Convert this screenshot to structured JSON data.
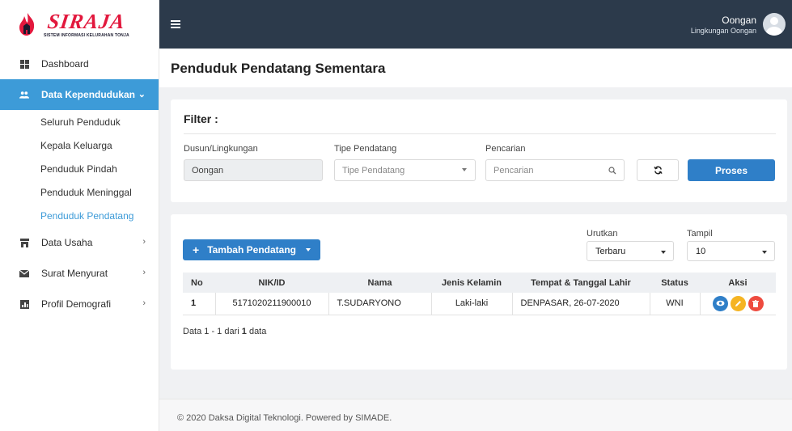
{
  "logo": {
    "word": "SIRAJA",
    "subtitle": "SISTEM INFORMASI KELURAHAN TONJA"
  },
  "sidebar": {
    "items": [
      {
        "label": "Dashboard"
      },
      {
        "label": "Data Kependudukan"
      },
      {
        "label": "Data Usaha"
      },
      {
        "label": "Surat Menyurat"
      },
      {
        "label": "Profil Demografi"
      }
    ],
    "sub_items": [
      {
        "label": "Seluruh Penduduk"
      },
      {
        "label": "Kepala Keluarga"
      },
      {
        "label": "Penduduk Pindah"
      },
      {
        "label": "Penduduk Meninggal"
      },
      {
        "label": "Penduduk Pendatang"
      }
    ]
  },
  "user": {
    "name": "Oongan",
    "location": "Lingkungan Oongan"
  },
  "page": {
    "title": "Penduduk Pendatang Sementara"
  },
  "filter": {
    "title": "Filter :",
    "dusun_label": "Dusun/Lingkungan",
    "dusun_value": "Oongan",
    "tipe_label": "Tipe Pendatang",
    "tipe_placeholder": "Tipe Pendatang",
    "search_label": "Pencarian",
    "search_placeholder": "Pencarian",
    "proses_label": "Proses"
  },
  "toolbar": {
    "add_label": "Tambah Pendatang",
    "sort_label": "Urutkan",
    "sort_value": "Terbaru",
    "show_label": "Tampil",
    "show_value": "10"
  },
  "table": {
    "headers": [
      "No",
      "NIK/ID",
      "Nama",
      "Jenis Kelamin",
      "Tempat & Tanggal Lahir",
      "Status",
      "Aksi"
    ],
    "rows": [
      {
        "no": "1",
        "nik": "5171020211900010",
        "nama": "T.SUDARYONO",
        "jk": "Laki-laki",
        "ttl": "DENPASAR, 26-07-2020",
        "status": "WNI"
      }
    ],
    "info_prefix": "Data 1 - 1 dari ",
    "info_total": "1",
    "info_suffix": " data"
  },
  "footer": {
    "text": "© 2020 Daksa Digital Teknologi. Powered by SIMADE."
  },
  "colors": {
    "primary": "#2f7fc8",
    "sidebar_active": "#3d9bd8",
    "topbar": "#2c3a4b",
    "edit": "#f5b423",
    "delete": "#ee4b3f",
    "logo_red": "#e2183d"
  }
}
